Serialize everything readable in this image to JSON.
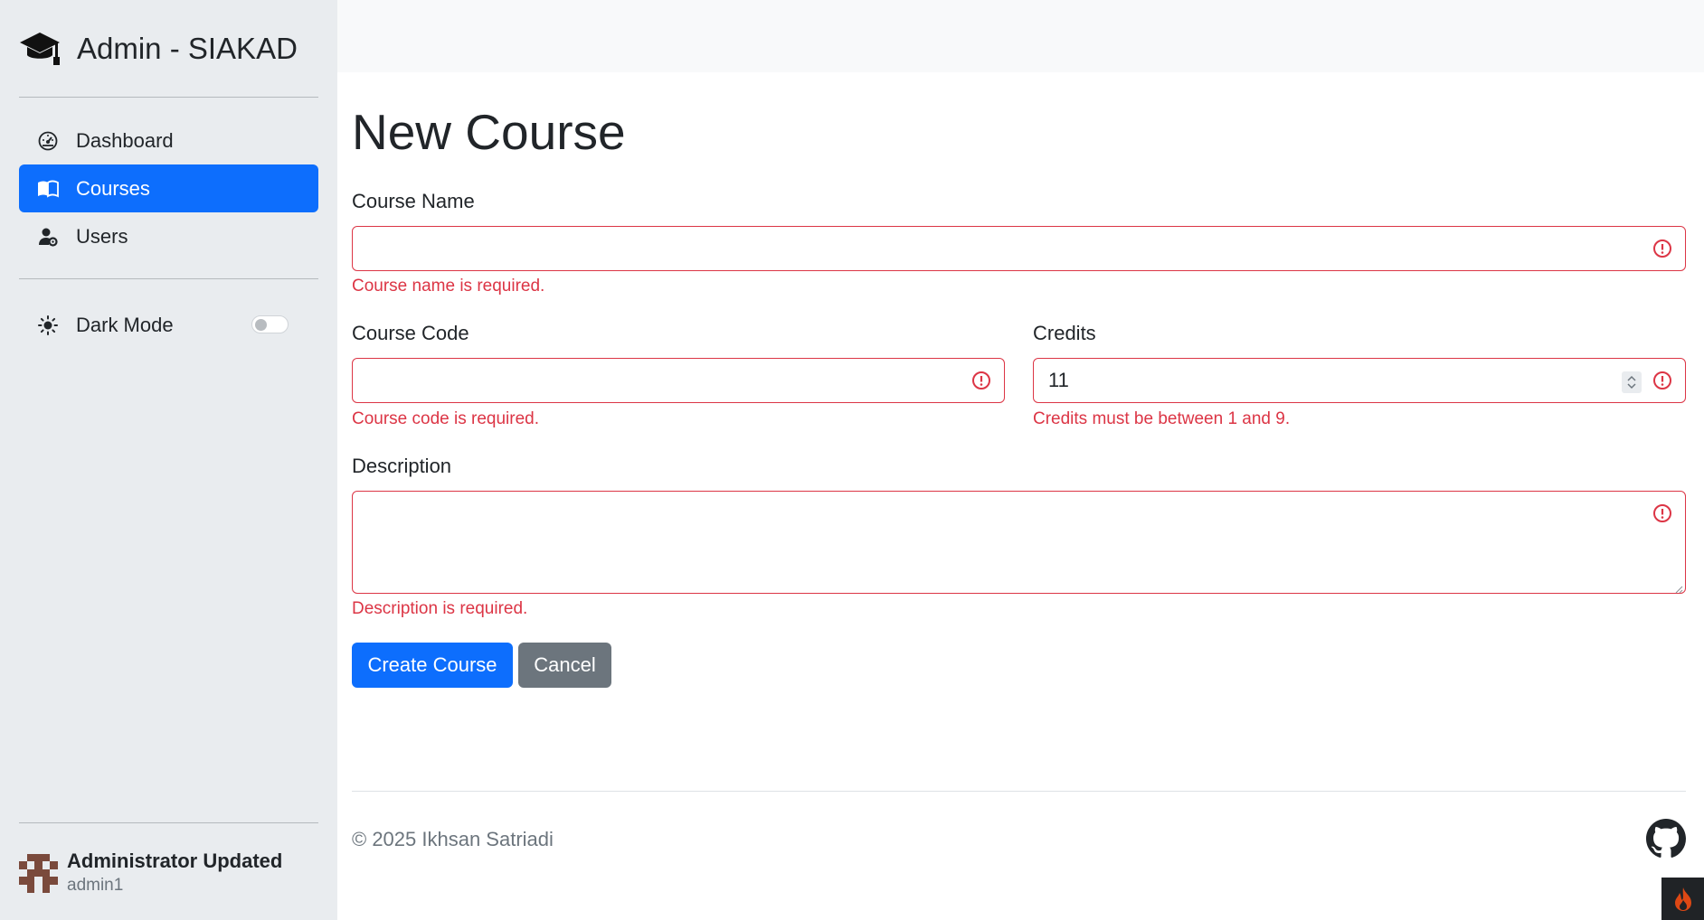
{
  "sidebar": {
    "brand_icon": "graduation-cap-icon",
    "title": "Admin - SIAKAD",
    "nav": [
      {
        "label": "Dashboard",
        "icon": "speedometer-icon",
        "active": false
      },
      {
        "label": "Courses",
        "icon": "book-icon",
        "active": true
      },
      {
        "label": "Users",
        "icon": "user-gear-icon",
        "active": false
      }
    ],
    "dark_mode": {
      "label": "Dark Mode",
      "icon": "sun-icon",
      "enabled": false
    },
    "user": {
      "name": "Administrator Updated",
      "login": "admin1"
    }
  },
  "form": {
    "title": "New Course",
    "course_name": {
      "label": "Course Name",
      "value": "",
      "error": "Course name is required."
    },
    "course_code": {
      "label": "Course Code",
      "value": "",
      "error": "Course code is required."
    },
    "credits": {
      "label": "Credits",
      "value": "11",
      "error": "Credits must be between 1 and 9."
    },
    "description": {
      "label": "Description",
      "value": "",
      "error": "Description is required."
    },
    "submit_label": "Create Course",
    "cancel_label": "Cancel"
  },
  "footer": {
    "text": "© 2025 Ikhsan Satriadi",
    "link_icon": "github-icon"
  },
  "colors": {
    "primary": "#0d6efd",
    "secondary": "#6c757d",
    "danger": "#dc3545",
    "sidebar_bg": "#e9ecef"
  }
}
